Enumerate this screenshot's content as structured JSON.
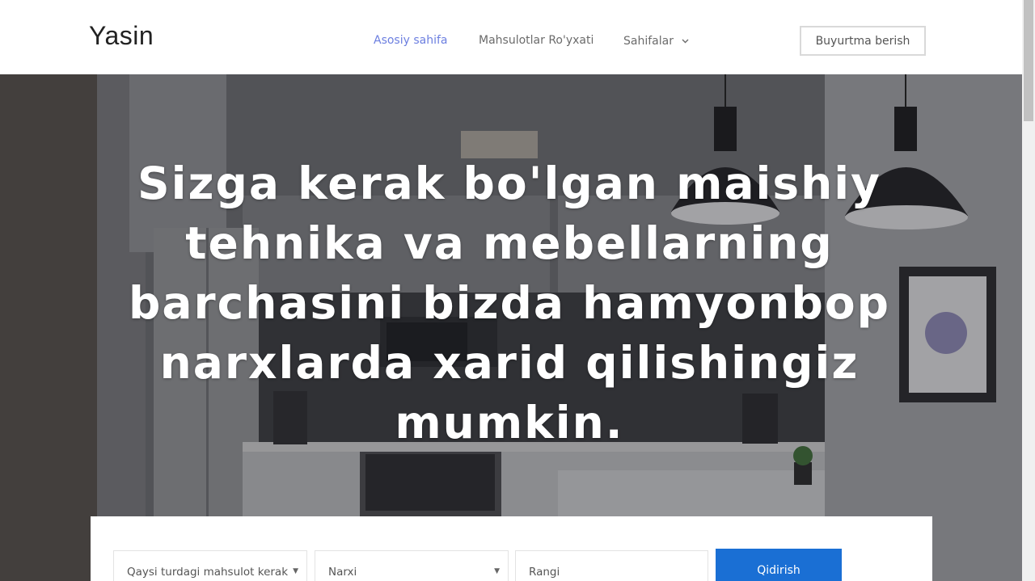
{
  "header": {
    "logo": "Yasin",
    "nav": [
      {
        "label": "Asosiy sahifa",
        "active": true
      },
      {
        "label": "Mahsulotlar Ro'yxati",
        "active": false
      },
      {
        "label": "Sahifalar",
        "active": false,
        "has_dropdown": true
      }
    ],
    "order_button": "Buyurtma berish"
  },
  "hero": {
    "title_lines": [
      "Sizga kerak bo'lgan maishiy",
      "tehnika va mebellarning",
      "barchasini bizda hamyonbop",
      "narxlarda xarid qilishingiz",
      "mumkin."
    ]
  },
  "search": {
    "type_select": "Qaysi turdagi mahsulot kerak",
    "price_select": "Narxi",
    "color_input_placeholder": "Rangi",
    "submit_label": "Qidirish"
  },
  "colors": {
    "accent_nav": "#6c7fe0",
    "search_button": "#1a6fd4"
  },
  "icons": {
    "dropdown": "chevron-down-icon",
    "select_caret": "caret-down-icon"
  }
}
